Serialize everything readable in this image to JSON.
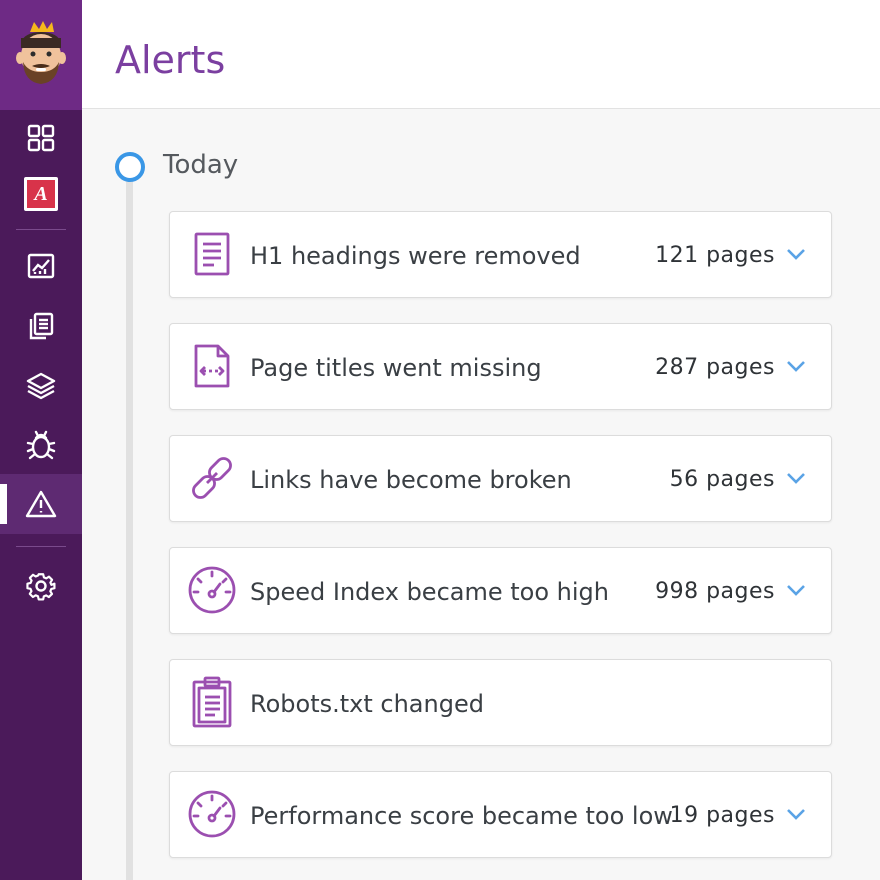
{
  "app": {
    "title": "Alerts"
  },
  "sidebar": {
    "items": [
      {
        "name": "dashboard",
        "icon": "grid-icon"
      },
      {
        "name": "accessibility",
        "icon": "a-badge-icon",
        "badge_letter": "A"
      },
      {
        "name": "analytics",
        "icon": "chart-icon"
      },
      {
        "name": "pages",
        "icon": "documents-icon"
      },
      {
        "name": "layers",
        "icon": "layers-icon"
      },
      {
        "name": "bugs",
        "icon": "bug-icon"
      },
      {
        "name": "alerts",
        "icon": "warning-icon",
        "active": true
      },
      {
        "name": "settings",
        "icon": "gear-icon"
      }
    ]
  },
  "timeline": {
    "day_label": "Today",
    "alerts": [
      {
        "label": "H1 headings were removed",
        "count": "121 pages",
        "icon": "document-icon",
        "expandable": true
      },
      {
        "label": "Page titles went missing",
        "count": "287 pages",
        "icon": "code-file-icon",
        "expandable": true
      },
      {
        "label": "Links have become broken",
        "count": "56 pages",
        "icon": "link-icon",
        "expandable": true
      },
      {
        "label": "Speed Index became too high",
        "count": "998 pages",
        "icon": "speedometer-icon",
        "expandable": true
      },
      {
        "label": "Robots.txt changed",
        "count": "",
        "icon": "clipboard-icon",
        "expandable": false
      },
      {
        "label": "Performance score became too low",
        "count": "19 pages",
        "icon": "speedometer-icon",
        "expandable": true
      }
    ]
  },
  "colors": {
    "sidebar": "#4b1a5a",
    "logo_bg": "#6e2a85",
    "accent": "#7b3fa0",
    "timeline_dot": "#3a97e6",
    "chevron": "#5aa3e6"
  }
}
